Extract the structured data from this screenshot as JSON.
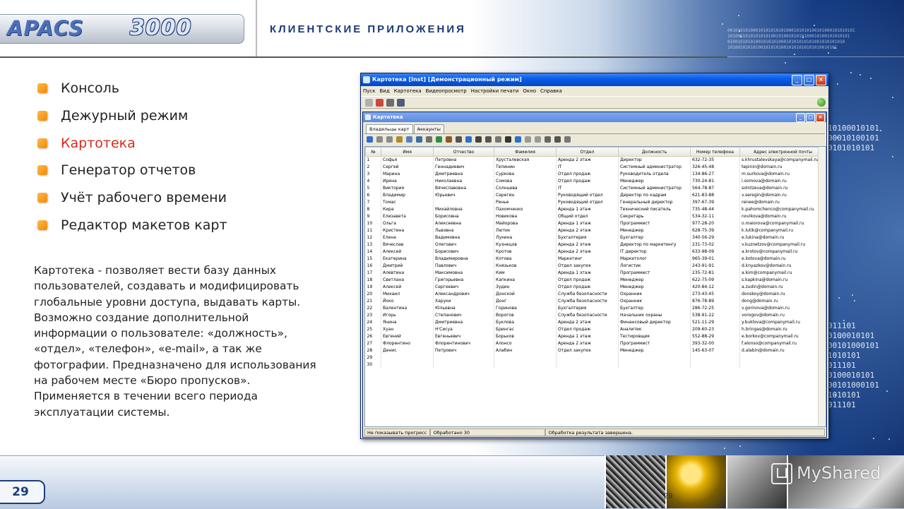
{
  "logo": {
    "brand": "APACS",
    "model": "3000"
  },
  "section_title": "КЛИЕНТСКИЕ ПРИЛОЖЕНИЯ",
  "menu": [
    {
      "label": "Консоль",
      "active": false
    },
    {
      "label": "Дежурный режим",
      "active": false
    },
    {
      "label": "Картотека",
      "active": true
    },
    {
      "label": "Генератор отчетов",
      "active": false
    },
    {
      "label": "Учёт рабочего времени",
      "active": false
    },
    {
      "label": "Редактор макетов карт",
      "active": false
    }
  ],
  "description": "Картотека - позволяет вести базу данных пользователей, создавать и модифицировать глобальные уровни доступа, выдавать карты. Возможно создание дополнительной информации о пользователе: «должность», «отдел», «телефон», «e-mail», а так же фотографии. Предназначено для использования на рабочем месте «Бюро пропусков». Применяется в течении всего периода эксплуатации системы.",
  "app": {
    "title": "Картотека [Inst] [Демонстрационный режим]",
    "menubar": [
      "Пуск",
      "Вид",
      "Картотека",
      "Видеопросмотр",
      "Настройки печати",
      "Окно",
      "Справка"
    ],
    "child_title": "Картотека",
    "tabs": [
      "Владельцы карт",
      "Аккаунты"
    ],
    "columns": [
      "№",
      "Имя",
      "Отчество",
      "Фамилия",
      "Отдел",
      "Должность",
      "Номер телефона",
      "Адрес электронной почты"
    ],
    "rows": [
      [
        "1",
        "Софья",
        "Петровна",
        "Хрусталевская",
        "Аренда 2 этаж",
        "Директор",
        "632-72-35",
        "s.khrustalevskaya@companymail.ru"
      ],
      [
        "2",
        "Сергей",
        "Геннадиевич",
        "Тепинин",
        "IT",
        "Системный администратор",
        "326-45-48",
        "tepinin@domain.ru"
      ],
      [
        "3",
        "Марина",
        "Дмитриевна",
        "Суркова",
        "Отдел продаж",
        "Руководитель отдела",
        "134-86-27",
        "m.surkova@domain.ru"
      ],
      [
        "4",
        "Ирина",
        "Николаевна",
        "Сомова",
        "Отдел продаж",
        "Менеджер",
        "730-24-81",
        "i.somova@domain.ru"
      ],
      [
        "5",
        "Виктория",
        "Вячеславовна",
        "Солнцева",
        "IT",
        "Системный администратор",
        "564-78-87",
        "solntzeva@domain.ru"
      ],
      [
        "6",
        "Владимир",
        "Юрьевич",
        "Серегин",
        "Руководящий отдел",
        "Директор по кадрам",
        "621-83-88",
        "v.seregin@domain.ru"
      ],
      [
        "7",
        "Томас",
        "",
        "Ренье",
        "Руководящий отдел",
        "Генеральный директор",
        "397-67-39",
        "renee@domain.ru"
      ],
      [
        "8",
        "Кира",
        "Михайловна",
        "Пахомченко",
        "Аренда 1 этаж",
        "Технический писатель",
        "735-48-44",
        "k.pahomchenco@companymail.ru"
      ],
      [
        "9",
        "Елизавета",
        "Борисовна",
        "Новикова",
        "Общий отдел",
        "Секретарь",
        "534-32-11",
        "novikova@domain.ru"
      ],
      [
        "10",
        "Ольга",
        "Алексеевна",
        "Майорова",
        "Аренда 1 этаж",
        "Программист",
        "977-28-20",
        "o.maiorova@companymail.ru"
      ],
      [
        "11",
        "Кристина",
        "Львовна",
        "Лютик",
        "Аренда 2 этаж",
        "Менеджер",
        "628-75-39",
        "k.lutik@companymail.ru"
      ],
      [
        "12",
        "Елена",
        "Вадимовна",
        "Лукина",
        "Бухгалтерия",
        "Бухгалтер",
        "340-56-29",
        "e.lukina@domain.ru"
      ],
      [
        "13",
        "Вячеслав",
        "Олегович",
        "Кузнецов",
        "Аренда 2 этаж",
        "Директор по маркетингу",
        "231-73-02",
        "v.kuznetzov@companymail.ru"
      ],
      [
        "14",
        "Алексей",
        "Борисович",
        "Кротов",
        "Аренда 2 этаж",
        "IT директор",
        "633-98-09",
        "a.krotov@companymail.ru"
      ],
      [
        "15",
        "Екатерина",
        "Владимировна",
        "Котова",
        "Маркетинг",
        "Маркетолог",
        "965-39-01",
        "e.kotova@domain.ru"
      ],
      [
        "16",
        "Дмитрий",
        "Павлович",
        "Князьков",
        "Отдел закупок",
        "Логистик",
        "243-91-91",
        "d.knyazkov@domain.ru"
      ],
      [
        "17",
        "Алевтина",
        "Максимовна",
        "Ким",
        "Аренда 1 этаж",
        "Программист",
        "235-72-81",
        "a.kim@companymail.ru"
      ],
      [
        "18",
        "Светлана",
        "Григорьевна",
        "Капкина",
        "Отдел продаж",
        "Менеджер",
        "622-75-09",
        "s.kapkina@domain.ru"
      ],
      [
        "19",
        "Алексей",
        "Сергеевич",
        "Зудин",
        "Отдел продаж",
        "Менеджер",
        "420-84-12",
        "a.zudin@domain.ru"
      ],
      [
        "20",
        "Михаил",
        "Александрович",
        "Донской",
        "Служба безопасности",
        "Охранник",
        "273-43-45",
        "donskoy@domain.ru"
      ],
      [
        "21",
        "Йоко",
        "Харуки",
        "Донг",
        "Служба безопасности",
        "Охранник",
        "876-78-89",
        "dong@domain.ru"
      ],
      [
        "22",
        "Валентина",
        "Юльевна",
        "Горинова",
        "Бухгалтерия",
        "Бухгалтер",
        "286-72-25",
        "v.gorinova@domain.ru"
      ],
      [
        "23",
        "Игорь",
        "Степанович",
        "Ворогов",
        "Служба безопасности",
        "Начальник охраны",
        "538-91-22",
        "vorogov@domain.ru"
      ],
      [
        "24",
        "Янина",
        "Дмитриевна",
        "Буклова",
        "Аренда 2 этаж",
        "Финансовый директор",
        "521-11-29",
        "y.buklova@companymail.ru"
      ],
      [
        "25",
        "Хуан",
        "Н'Сисуа",
        "Брингас",
        "Отдел продаж",
        "Аналитик",
        "209-60-23",
        "h.bringas@domain.ru"
      ],
      [
        "26",
        "Евгений",
        "Евгеньевич",
        "Борьков",
        "Аренда 1 этаж",
        "Тестировщик",
        "552-88-29",
        "e.borkov@companymail.ru"
      ],
      [
        "27",
        "Флорентино",
        "Флорентинович",
        "Алонсо",
        "Аренда 2 этаж",
        "Программист",
        "393-32-00",
        "f.alonso@companymail.ru"
      ],
      [
        "28",
        "Денис",
        "Петрович",
        "Алабин",
        "Отдел закупок",
        "Менеджер",
        "145-63-07",
        "d.alabin@domain.ru"
      ],
      [
        "29",
        "",
        "",
        "",
        "",
        "",
        "",
        ""
      ],
      [
        "30",
        "",
        "",
        "",
        "",
        "",
        "",
        ""
      ]
    ],
    "status": [
      "Не показывать прогресс",
      "Обработано 30",
      "Обработка результата завершена."
    ]
  },
  "binary_right": "10100010101\n00010100101\n0101010101",
  "binary_right2": "011101\n0100010101\n00101000101\n1010101\n011101\n0100010101\n00101000101\n1010101\n011101",
  "binary_top": "00101010100010101010101000101010100101000101010101\n101000101010101010010100101010100010100101010101\n0100101010100101010100010101010101001010101010\n1010010101010010101010010101010101010010101",
  "page_number": "29",
  "page_number_small": "29",
  "watermark": "MyShared",
  "colors": {
    "accent": "#f39c12",
    "active_item": "#d9291c",
    "title": "#1b3a73"
  }
}
